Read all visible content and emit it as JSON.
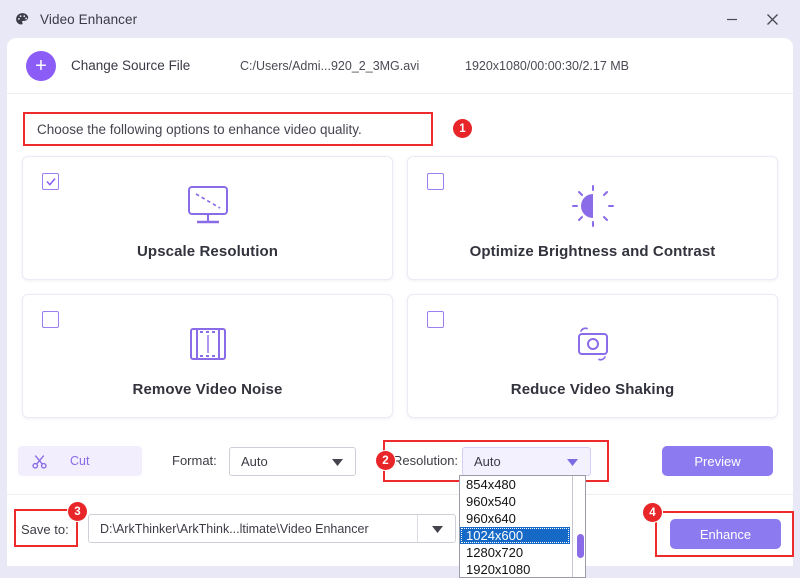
{
  "window": {
    "title": "Video Enhancer",
    "app_icon": "palette-icon",
    "controls": {
      "minimize": "minimize-icon",
      "close": "close-icon"
    },
    "accent": "#8b7af0",
    "highlight": "#ee2b2b",
    "titlebar_bg": "#e9e8f7"
  },
  "source": {
    "add_icon": "plus-icon",
    "change_label": "Change Source File",
    "path": "C:/Users/Admi...920_2_3MG.avi",
    "meta": "1920x1080/00:00:30/2.17 MB"
  },
  "instruction": {
    "text": "Choose the following options to enhance video quality.",
    "badge": "1"
  },
  "options": [
    {
      "label": "Upscale Resolution",
      "icon": "monitor-upscale-icon",
      "checked": true
    },
    {
      "label": "Optimize Brightness and Contrast",
      "icon": "brightness-sun-icon",
      "checked": false
    },
    {
      "label": "Remove Video Noise",
      "icon": "film-strip-icon",
      "checked": false
    },
    {
      "label": "Reduce Video Shaking",
      "icon": "camera-stabilize-icon",
      "checked": false
    }
  ],
  "controls": {
    "cut_label": "Cut",
    "cut_icon": "scissors-icon",
    "format_label": "Format:",
    "format_value": "Auto",
    "resolution_label": "Resolution:",
    "resolution_value": "Auto",
    "resolution_badge": "2",
    "preview_label": "Preview",
    "dropdown_icon": "chevron-down-icon"
  },
  "resolution_dropdown": {
    "options": [
      "854x480",
      "960x540",
      "960x640",
      "1024x600",
      "1280x720",
      "1920x1080"
    ],
    "selected": "1024x600",
    "selected_bg": "#1669c6"
  },
  "save": {
    "label": "Save to:",
    "badge": "3",
    "path": "D:\\ArkThinker\\ArkThink...ltimate\\Video Enhancer",
    "dropdown_icon": "chevron-down-icon"
  },
  "enhance": {
    "label": "Enhance",
    "badge": "4"
  }
}
